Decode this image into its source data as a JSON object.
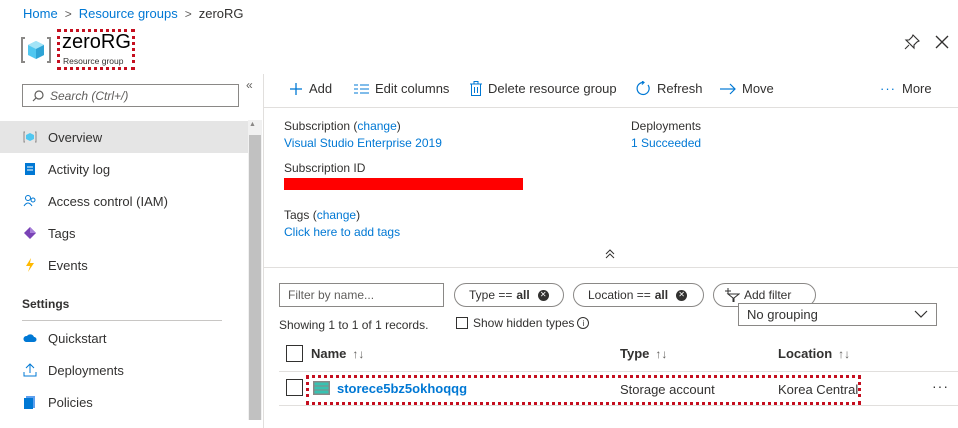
{
  "breadcrumb": {
    "home": "Home",
    "resource_groups": "Resource groups",
    "current": "zeroRG"
  },
  "header": {
    "title": "zeroRG",
    "subtitle": "Resource group"
  },
  "sidebar": {
    "search_placeholder": "Search (Ctrl+/)",
    "items": [
      {
        "label": "Overview",
        "icon": "resource-group-icon",
        "active": true
      },
      {
        "label": "Activity log",
        "icon": "activity-log-icon"
      },
      {
        "label": "Access control (IAM)",
        "icon": "people-icon"
      },
      {
        "label": "Tags",
        "icon": "tag-icon"
      },
      {
        "label": "Events",
        "icon": "lightning-icon"
      }
    ],
    "section_settings": "Settings",
    "settings_items": [
      {
        "label": "Quickstart",
        "icon": "cloud-icon"
      },
      {
        "label": "Deployments",
        "icon": "upload-icon"
      },
      {
        "label": "Policies",
        "icon": "policy-icon"
      }
    ]
  },
  "toolbar": {
    "add": "Add",
    "edit_columns": "Edit columns",
    "delete": "Delete resource group",
    "refresh": "Refresh",
    "move": "Move",
    "more": "More"
  },
  "essentials": {
    "subscription_label": "Subscription",
    "change": "change",
    "subscription_value": "Visual Studio Enterprise 2019",
    "subscription_id_label": "Subscription ID",
    "tags_label": "Tags",
    "tags_value": "Click here to add tags",
    "deployments_label": "Deployments",
    "deployments_value": "1 Succeeded"
  },
  "filters": {
    "name_placeholder": "Filter by name...",
    "type_filter_label": "Type ==",
    "type_filter_value": "all",
    "location_filter_label": "Location ==",
    "location_filter_value": "all",
    "add_filter": "Add filter",
    "grouping": "No grouping",
    "showing": "Showing 1 to 1 of 1 records.",
    "show_hidden": "Show hidden types"
  },
  "table": {
    "columns": [
      "Name",
      "Type",
      "Location"
    ],
    "rows": [
      {
        "name": "storece5bz5okhoqqg",
        "type": "Storage account",
        "location": "Korea Central"
      }
    ]
  },
  "colors": {
    "accent": "#0078d4",
    "highlight": "#c50f1f",
    "redaction": "#ff0000"
  }
}
